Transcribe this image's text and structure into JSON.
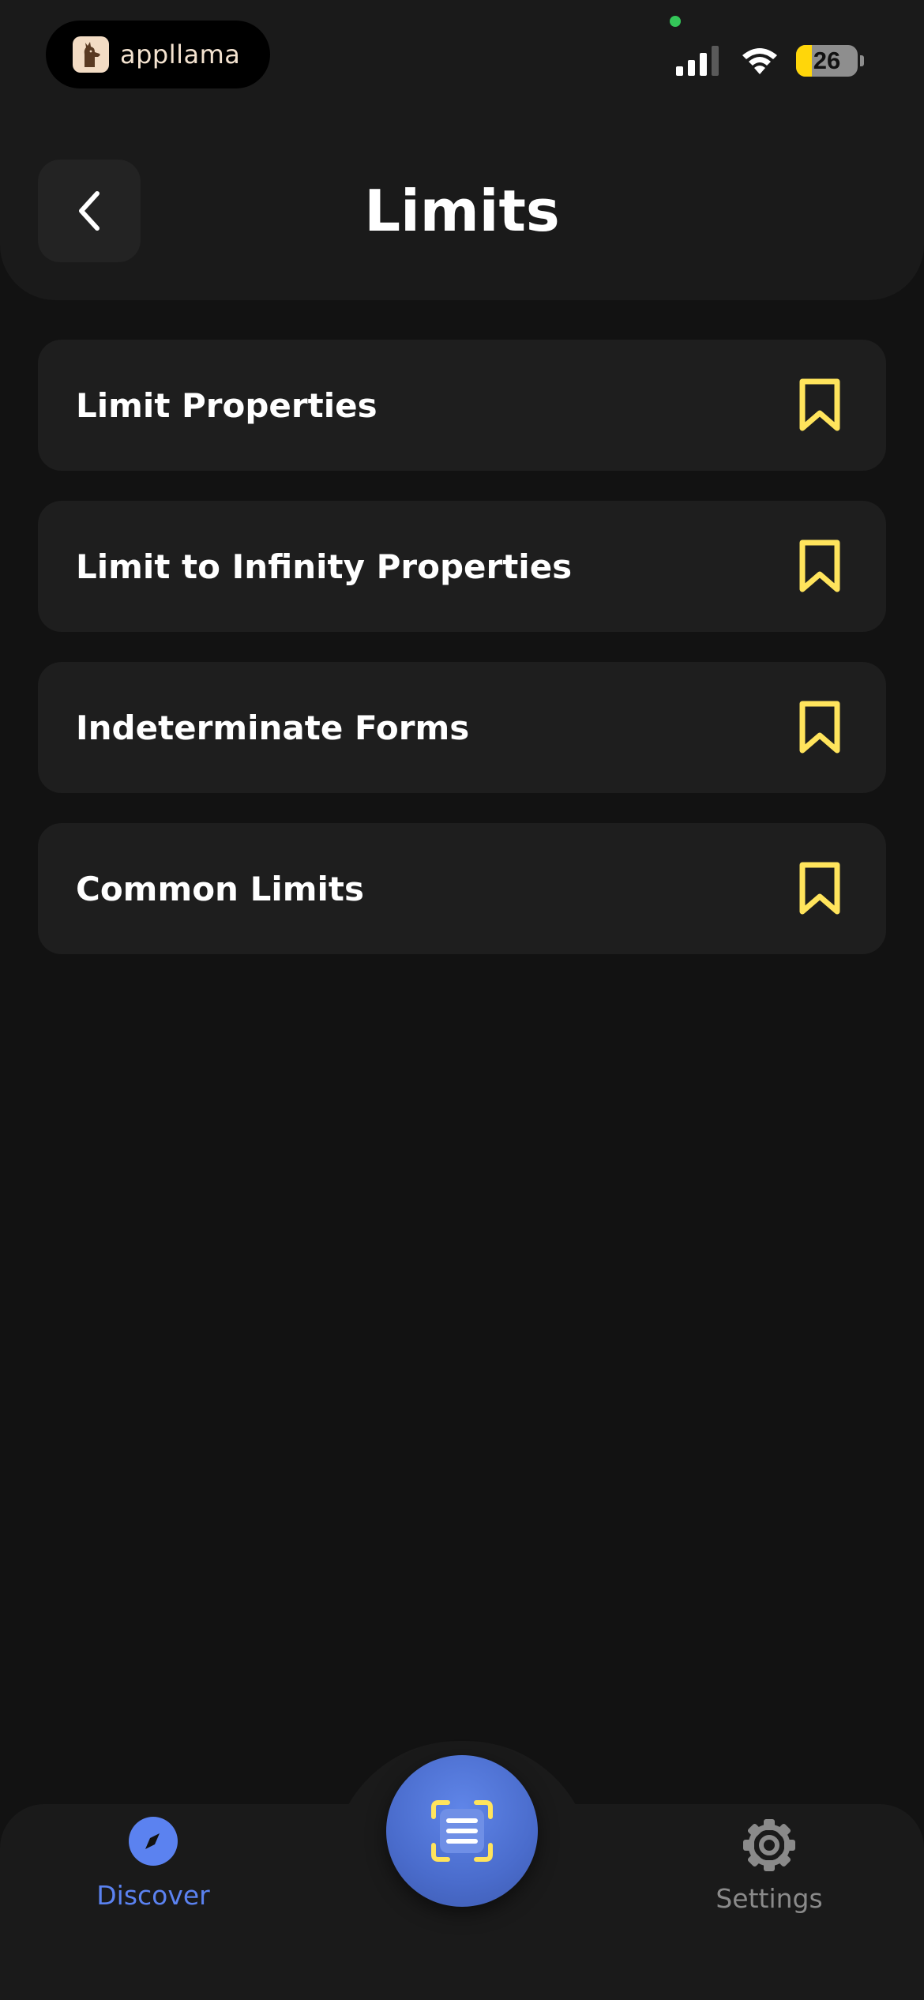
{
  "status_bar": {
    "app_name": "appllama",
    "battery_level": "26",
    "battery_fraction": 0.26,
    "icons": [
      "cellular-signal-icon",
      "wifi-icon",
      "battery-icon"
    ]
  },
  "header": {
    "title": "Limits",
    "back_icon": "chevron-left-icon"
  },
  "topics": [
    {
      "title": "Limit Properties",
      "icon": "bookmark-icon"
    },
    {
      "title": "Limit to Infinity Properties",
      "icon": "bookmark-icon"
    },
    {
      "title": "Indeterminate Forms",
      "icon": "bookmark-icon"
    },
    {
      "title": "Common Limits",
      "icon": "bookmark-icon"
    }
  ],
  "bottom_nav": {
    "discover_label": "Discover",
    "settings_label": "Settings",
    "center_icon": "scan-document-icon"
  },
  "colors": {
    "background": "#121212",
    "surface": "#1e1e1e",
    "bookmark": "#ffe45c",
    "accent_blue": "#5b82f0",
    "inactive": "#8a8a8a",
    "battery": "#ffd60a"
  }
}
